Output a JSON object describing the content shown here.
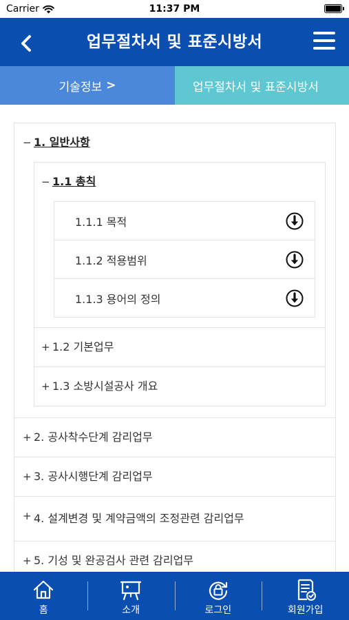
{
  "status_bar": {
    "carrier": "Carrier",
    "time": "11:37 PM"
  },
  "header": {
    "title": "업무절차서 및 표준시방서"
  },
  "breadcrumb": {
    "parent": "기술정보",
    "parent_chevron": ">",
    "current": "업무절차서 및 표준시방서"
  },
  "tree": {
    "section1": {
      "toggle": "−",
      "label": "1. 일반사항",
      "sub1": {
        "toggle": "−",
        "label": "1.1 총칙",
        "leaves": [
          "1.1.1 목적",
          "1.1.2 적용범위",
          "1.1.3 용어의 정의"
        ]
      },
      "sub2": {
        "toggle": "+",
        "label": "1.2 기본업무"
      },
      "sub3": {
        "toggle": "+",
        "label": "1.3 소방시설공사 개요"
      }
    },
    "section2": {
      "toggle": "+",
      "label": "2. 공사착수단계 감리업무"
    },
    "section3": {
      "toggle": "+",
      "label": "3. 공사시행단계 감리업무"
    },
    "section4": {
      "toggle": "+",
      "label": "4. 설계변경 및 계약금액의 조정관련 감리업무"
    },
    "section5": {
      "toggle": "+",
      "label": "5. 기성 및 완공검사 관련 감리업무"
    }
  },
  "tabs": {
    "home": "홈",
    "intro": "소개",
    "login": "로그인",
    "signup": "회원가입"
  },
  "colors": {
    "primary": "#0a4fb0",
    "breadcrumb_parent": "#4c88d9",
    "breadcrumb_current": "#5fc7d1"
  }
}
